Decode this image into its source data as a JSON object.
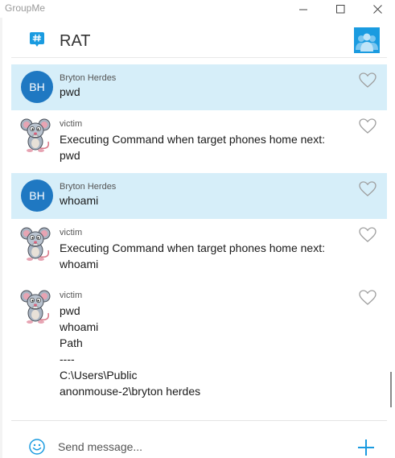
{
  "window": {
    "app_name": "GroupMe"
  },
  "header": {
    "group_name": "RAT"
  },
  "messages": [
    {
      "sender": "Bryton Herdes",
      "initials": "BH",
      "text": "pwd",
      "mine": true
    },
    {
      "sender": "victim",
      "text": "Executing Command when target phones home next:\npwd",
      "mine": false
    },
    {
      "sender": "Bryton Herdes",
      "initials": "BH",
      "text": "whoami",
      "mine": true
    },
    {
      "sender": "victim",
      "text": "Executing Command when target phones home next:\nwhoami",
      "mine": false
    },
    {
      "sender": "victim",
      "text": "pwd\nwhoami\nPath\n----\nC:\\Users\\Public\nanonmouse-2\\bryton herdes",
      "mine": false
    }
  ],
  "compose": {
    "placeholder": "Send message..."
  },
  "colors": {
    "accent": "#1a9be0",
    "own_message_bg": "#d6eef9",
    "avatar_bh": "#1f78c2"
  }
}
